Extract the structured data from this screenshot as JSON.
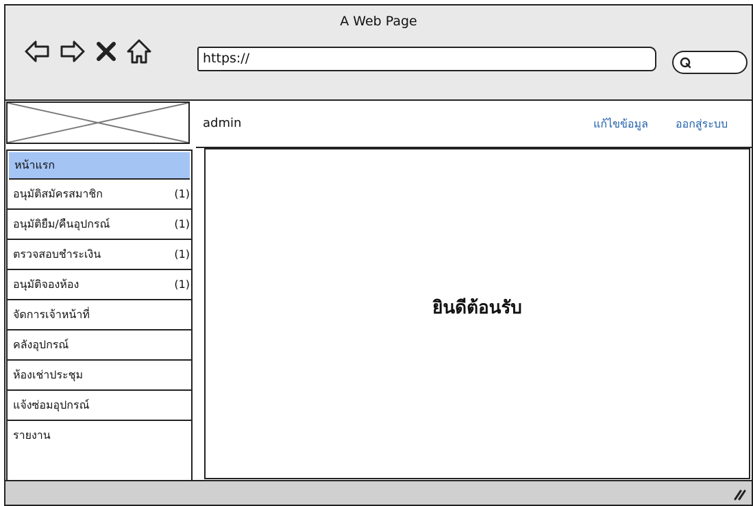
{
  "window": {
    "title": "A Web Page"
  },
  "address_bar": {
    "value": "https://"
  },
  "topbar": {
    "user": "admin",
    "edit_profile": "แก้ไขข้อมูล",
    "logout": "ออกสู่ระบบ"
  },
  "sidebar": {
    "items": [
      {
        "label": "หน้าแรก",
        "count": ""
      },
      {
        "label": "อนุมัติสมัครสมาชิก",
        "count": "(1)"
      },
      {
        "label": "อนุมัติยืม/คืนอุปกรณ์",
        "count": "(1)"
      },
      {
        "label": "ตรวจสอบชำระเงิน",
        "count": "(1)"
      },
      {
        "label": "อนุมัติจองห้อง",
        "count": "(1)"
      },
      {
        "label": "จัดการเจ้าหน้าที่",
        "count": ""
      },
      {
        "label": "คลังอุปกรณ์",
        "count": ""
      },
      {
        "label": "ห้องเช่าประชุม",
        "count": ""
      },
      {
        "label": "แจ้งซ่อมอุปกรณ์",
        "count": ""
      },
      {
        "label": "รายงาน",
        "count": ""
      }
    ]
  },
  "main": {
    "welcome": "ยินดีต้อนรับ"
  },
  "colors": {
    "active_item": "#a4c4f4",
    "link": "#1f5fa8"
  }
}
